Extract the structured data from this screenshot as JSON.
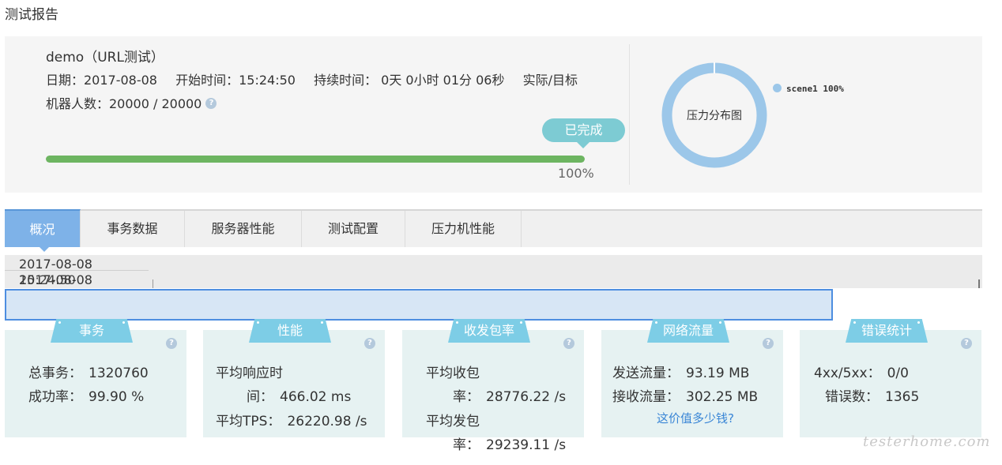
{
  "page": {
    "title": "测试报告"
  },
  "summary": {
    "test_name": "demo（URL测试）",
    "date": "日期：2017-08-08",
    "start_time": "开始时间：15:24:50",
    "duration": "持续时间： 0天 0小时 01分 06秒",
    "actual_target": "实际/目标",
    "robots": "机器人数：20000 / 20000",
    "help_glyph": "?",
    "status": "已完成",
    "progress": {
      "value": 100,
      "label": "100%"
    }
  },
  "pressure_chart": {
    "center_label": "压力分布图",
    "legend": "scene1 100%",
    "color": "#9cc7e9"
  },
  "chart_data": {
    "type": "pie",
    "categories": [
      "scene1"
    ],
    "values": [
      100
    ],
    "title": "压力分布图"
  },
  "tabs": [
    {
      "label": "概况",
      "active": true
    },
    {
      "label": "事务数据",
      "active": false
    },
    {
      "label": "服务器性能",
      "active": false
    },
    {
      "label": "测试配置",
      "active": false
    },
    {
      "label": "压力机性能",
      "active": false
    }
  ],
  "timeline": {
    "date_top": "2017-08-08",
    "date_bottom": "2017-08-08",
    "time_overlap": "15:24:50"
  },
  "cards": [
    {
      "tag": "事务",
      "metrics": [
        {
          "label": "总事务：",
          "value": "1320760"
        },
        {
          "label": "成功率：",
          "value": "99.90 %"
        }
      ]
    },
    {
      "tag": "性能",
      "metrics": [
        {
          "label": "平均响应时",
          "value": ""
        },
        {
          "label": "间：",
          "value": "466.02 ms"
        },
        {
          "label": "平均TPS：",
          "value": "26220.98 /s"
        }
      ]
    },
    {
      "tag": "收发包率",
      "metrics": [
        {
          "label": "平均收包",
          "value": ""
        },
        {
          "label": "率：",
          "value": "28776.22 /s"
        },
        {
          "label": "平均发包",
          "value": ""
        },
        {
          "label": "率：",
          "value": "29239.11 /s"
        }
      ]
    },
    {
      "tag": "网络流量",
      "metrics": [
        {
          "label": "发送流量：",
          "value": "93.19 MB"
        },
        {
          "label": "接收流量：",
          "value": "302.25 MB"
        }
      ],
      "link": "这价值多少钱?"
    },
    {
      "tag": "错误统计",
      "metrics": [
        {
          "label": "4xx/5xx：",
          "value": "0/0"
        },
        {
          "label": "错误数：",
          "value": "1365"
        }
      ]
    }
  ],
  "watermark": "testerhome.com"
}
